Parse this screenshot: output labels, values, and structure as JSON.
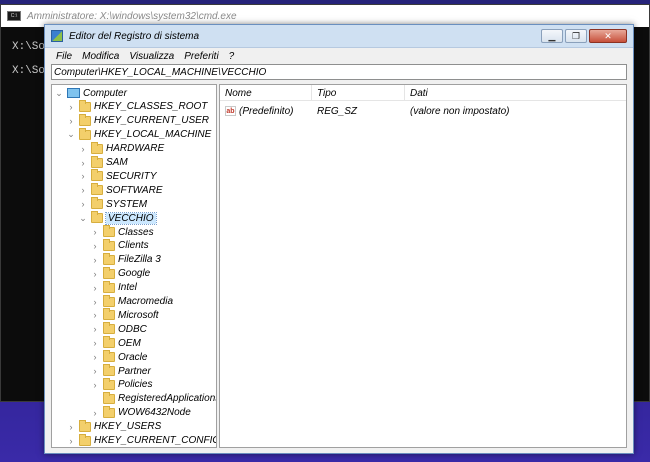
{
  "cmd": {
    "title": "Amministratore: X:\\windows\\system32\\cmd.exe",
    "lines": [
      "X:\\So",
      "X:\\So"
    ]
  },
  "regedit": {
    "title": "Editor del Registro di sistema",
    "menu": [
      "File",
      "Modifica",
      "Visualizza",
      "Preferiti",
      "?"
    ],
    "address": "Computer\\HKEY_LOCAL_MACHINE\\VECCHIO",
    "tree": [
      {
        "label": "Computer",
        "depth": 0,
        "expander": "open",
        "icon": "computer-icon"
      },
      {
        "label": "HKEY_CLASSES_ROOT",
        "depth": 1,
        "expander": "closed",
        "icon": "folder-icon"
      },
      {
        "label": "HKEY_CURRENT_USER",
        "depth": 1,
        "expander": "closed",
        "icon": "folder-icon"
      },
      {
        "label": "HKEY_LOCAL_MACHINE",
        "depth": 1,
        "expander": "open",
        "icon": "folder-icon"
      },
      {
        "label": "HARDWARE",
        "depth": 2,
        "expander": "closed",
        "icon": "folder-icon"
      },
      {
        "label": "SAM",
        "depth": 2,
        "expander": "closed",
        "icon": "folder-icon"
      },
      {
        "label": "SECURITY",
        "depth": 2,
        "expander": "closed",
        "icon": "folder-icon"
      },
      {
        "label": "SOFTWARE",
        "depth": 2,
        "expander": "closed",
        "icon": "folder-icon"
      },
      {
        "label": "SYSTEM",
        "depth": 2,
        "expander": "closed",
        "icon": "folder-icon"
      },
      {
        "label": "VECCHIO",
        "depth": 2,
        "expander": "open",
        "icon": "folder-icon",
        "selected": true
      },
      {
        "label": "Classes",
        "depth": 3,
        "expander": "closed",
        "icon": "folder-icon"
      },
      {
        "label": "Clients",
        "depth": 3,
        "expander": "closed",
        "icon": "folder-icon"
      },
      {
        "label": "FileZilla 3",
        "depth": 3,
        "expander": "closed",
        "icon": "folder-icon"
      },
      {
        "label": "Google",
        "depth": 3,
        "expander": "closed",
        "icon": "folder-icon"
      },
      {
        "label": "Intel",
        "depth": 3,
        "expander": "closed",
        "icon": "folder-icon"
      },
      {
        "label": "Macromedia",
        "depth": 3,
        "expander": "closed",
        "icon": "folder-icon"
      },
      {
        "label": "Microsoft",
        "depth": 3,
        "expander": "closed",
        "icon": "folder-icon"
      },
      {
        "label": "ODBC",
        "depth": 3,
        "expander": "closed",
        "icon": "folder-icon"
      },
      {
        "label": "OEM",
        "depth": 3,
        "expander": "closed",
        "icon": "folder-icon"
      },
      {
        "label": "Oracle",
        "depth": 3,
        "expander": "closed",
        "icon": "folder-icon"
      },
      {
        "label": "Partner",
        "depth": 3,
        "expander": "closed",
        "icon": "folder-icon"
      },
      {
        "label": "Policies",
        "depth": 3,
        "expander": "closed",
        "icon": "folder-icon"
      },
      {
        "label": "RegisteredApplications",
        "depth": 3,
        "expander": "none",
        "icon": "folder-icon"
      },
      {
        "label": "WOW6432Node",
        "depth": 3,
        "expander": "closed",
        "icon": "folder-icon"
      },
      {
        "label": "HKEY_USERS",
        "depth": 1,
        "expander": "closed",
        "icon": "folder-icon"
      },
      {
        "label": "HKEY_CURRENT_CONFIG",
        "depth": 1,
        "expander": "closed",
        "icon": "folder-icon"
      }
    ],
    "columns": [
      "Nome",
      "Tipo",
      "Dati"
    ],
    "values": [
      {
        "name": "(Predefinito)",
        "type": "REG_SZ",
        "data": "(valore non impostato)",
        "icon": "string-value-icon"
      }
    ]
  }
}
